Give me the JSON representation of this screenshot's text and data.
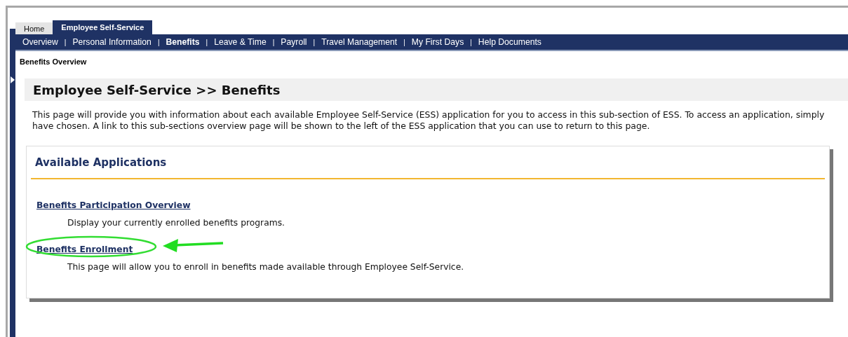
{
  "top_tabs": [
    {
      "label": "Home",
      "selected": false
    },
    {
      "label": "Employee Self-Service",
      "selected": true
    }
  ],
  "nav": [
    {
      "label": "Overview",
      "selected": false
    },
    {
      "label": "Personal Information",
      "selected": false
    },
    {
      "label": "Benefits",
      "selected": true
    },
    {
      "label": "Leave & Time",
      "selected": false
    },
    {
      "label": "Payroll",
      "selected": false
    },
    {
      "label": "Travel Management",
      "selected": false
    },
    {
      "label": "My First Days",
      "selected": false
    },
    {
      "label": "Help Documents",
      "selected": false
    }
  ],
  "nav_separator": "|",
  "breadcrumb": "Benefits Overview",
  "page_title": "Employee Self-Service >> Benefits",
  "intro_lines": [
    "This page will provide you with information about each available Employee Self-Service (ESS) application for you to access in this sub-section of ESS. To access an application, simply",
    "have chosen. A link to this sub-sections overview page will be shown to the left of the ESS application that you can use to return to this page."
  ],
  "card": {
    "title": "Available Applications",
    "applications": [
      {
        "link": "Benefits Participation Overview",
        "description": "Display your currently enrolled benefits programs.",
        "highlighted": false
      },
      {
        "link": "Benefits Enrollment",
        "description": "This page will allow you to enroll in benefits made available through Employee Self-Service.",
        "highlighted": true
      }
    ]
  }
}
